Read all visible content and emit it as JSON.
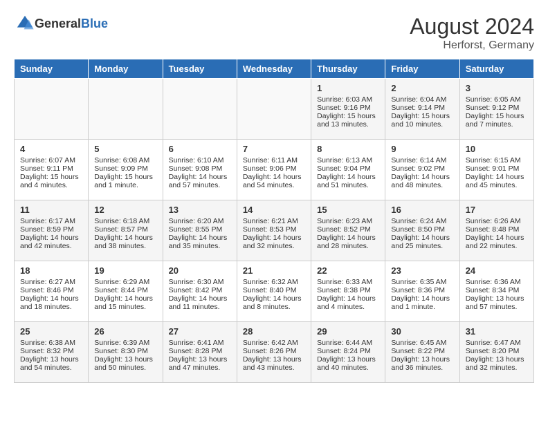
{
  "header": {
    "logo_general": "General",
    "logo_blue": "Blue",
    "month_year": "August 2024",
    "location": "Herforst, Germany"
  },
  "days_of_week": [
    "Sunday",
    "Monday",
    "Tuesday",
    "Wednesday",
    "Thursday",
    "Friday",
    "Saturday"
  ],
  "weeks": [
    [
      {
        "day": "",
        "info": ""
      },
      {
        "day": "",
        "info": ""
      },
      {
        "day": "",
        "info": ""
      },
      {
        "day": "",
        "info": ""
      },
      {
        "day": "1",
        "info": "Sunrise: 6:03 AM\nSunset: 9:16 PM\nDaylight: 15 hours\nand 13 minutes."
      },
      {
        "day": "2",
        "info": "Sunrise: 6:04 AM\nSunset: 9:14 PM\nDaylight: 15 hours\nand 10 minutes."
      },
      {
        "day": "3",
        "info": "Sunrise: 6:05 AM\nSunset: 9:12 PM\nDaylight: 15 hours\nand 7 minutes."
      }
    ],
    [
      {
        "day": "4",
        "info": "Sunrise: 6:07 AM\nSunset: 9:11 PM\nDaylight: 15 hours\nand 4 minutes."
      },
      {
        "day": "5",
        "info": "Sunrise: 6:08 AM\nSunset: 9:09 PM\nDaylight: 15 hours\nand 1 minute."
      },
      {
        "day": "6",
        "info": "Sunrise: 6:10 AM\nSunset: 9:08 PM\nDaylight: 14 hours\nand 57 minutes."
      },
      {
        "day": "7",
        "info": "Sunrise: 6:11 AM\nSunset: 9:06 PM\nDaylight: 14 hours\nand 54 minutes."
      },
      {
        "day": "8",
        "info": "Sunrise: 6:13 AM\nSunset: 9:04 PM\nDaylight: 14 hours\nand 51 minutes."
      },
      {
        "day": "9",
        "info": "Sunrise: 6:14 AM\nSunset: 9:02 PM\nDaylight: 14 hours\nand 48 minutes."
      },
      {
        "day": "10",
        "info": "Sunrise: 6:15 AM\nSunset: 9:01 PM\nDaylight: 14 hours\nand 45 minutes."
      }
    ],
    [
      {
        "day": "11",
        "info": "Sunrise: 6:17 AM\nSunset: 8:59 PM\nDaylight: 14 hours\nand 42 minutes."
      },
      {
        "day": "12",
        "info": "Sunrise: 6:18 AM\nSunset: 8:57 PM\nDaylight: 14 hours\nand 38 minutes."
      },
      {
        "day": "13",
        "info": "Sunrise: 6:20 AM\nSunset: 8:55 PM\nDaylight: 14 hours\nand 35 minutes."
      },
      {
        "day": "14",
        "info": "Sunrise: 6:21 AM\nSunset: 8:53 PM\nDaylight: 14 hours\nand 32 minutes."
      },
      {
        "day": "15",
        "info": "Sunrise: 6:23 AM\nSunset: 8:52 PM\nDaylight: 14 hours\nand 28 minutes."
      },
      {
        "day": "16",
        "info": "Sunrise: 6:24 AM\nSunset: 8:50 PM\nDaylight: 14 hours\nand 25 minutes."
      },
      {
        "day": "17",
        "info": "Sunrise: 6:26 AM\nSunset: 8:48 PM\nDaylight: 14 hours\nand 22 minutes."
      }
    ],
    [
      {
        "day": "18",
        "info": "Sunrise: 6:27 AM\nSunset: 8:46 PM\nDaylight: 14 hours\nand 18 minutes."
      },
      {
        "day": "19",
        "info": "Sunrise: 6:29 AM\nSunset: 8:44 PM\nDaylight: 14 hours\nand 15 minutes."
      },
      {
        "day": "20",
        "info": "Sunrise: 6:30 AM\nSunset: 8:42 PM\nDaylight: 14 hours\nand 11 minutes."
      },
      {
        "day": "21",
        "info": "Sunrise: 6:32 AM\nSunset: 8:40 PM\nDaylight: 14 hours\nand 8 minutes."
      },
      {
        "day": "22",
        "info": "Sunrise: 6:33 AM\nSunset: 8:38 PM\nDaylight: 14 hours\nand 4 minutes."
      },
      {
        "day": "23",
        "info": "Sunrise: 6:35 AM\nSunset: 8:36 PM\nDaylight: 14 hours\nand 1 minute."
      },
      {
        "day": "24",
        "info": "Sunrise: 6:36 AM\nSunset: 8:34 PM\nDaylight: 13 hours\nand 57 minutes."
      }
    ],
    [
      {
        "day": "25",
        "info": "Sunrise: 6:38 AM\nSunset: 8:32 PM\nDaylight: 13 hours\nand 54 minutes."
      },
      {
        "day": "26",
        "info": "Sunrise: 6:39 AM\nSunset: 8:30 PM\nDaylight: 13 hours\nand 50 minutes."
      },
      {
        "day": "27",
        "info": "Sunrise: 6:41 AM\nSunset: 8:28 PM\nDaylight: 13 hours\nand 47 minutes."
      },
      {
        "day": "28",
        "info": "Sunrise: 6:42 AM\nSunset: 8:26 PM\nDaylight: 13 hours\nand 43 minutes."
      },
      {
        "day": "29",
        "info": "Sunrise: 6:44 AM\nSunset: 8:24 PM\nDaylight: 13 hours\nand 40 minutes."
      },
      {
        "day": "30",
        "info": "Sunrise: 6:45 AM\nSunset: 8:22 PM\nDaylight: 13 hours\nand 36 minutes."
      },
      {
        "day": "31",
        "info": "Sunrise: 6:47 AM\nSunset: 8:20 PM\nDaylight: 13 hours\nand 32 minutes."
      }
    ]
  ]
}
